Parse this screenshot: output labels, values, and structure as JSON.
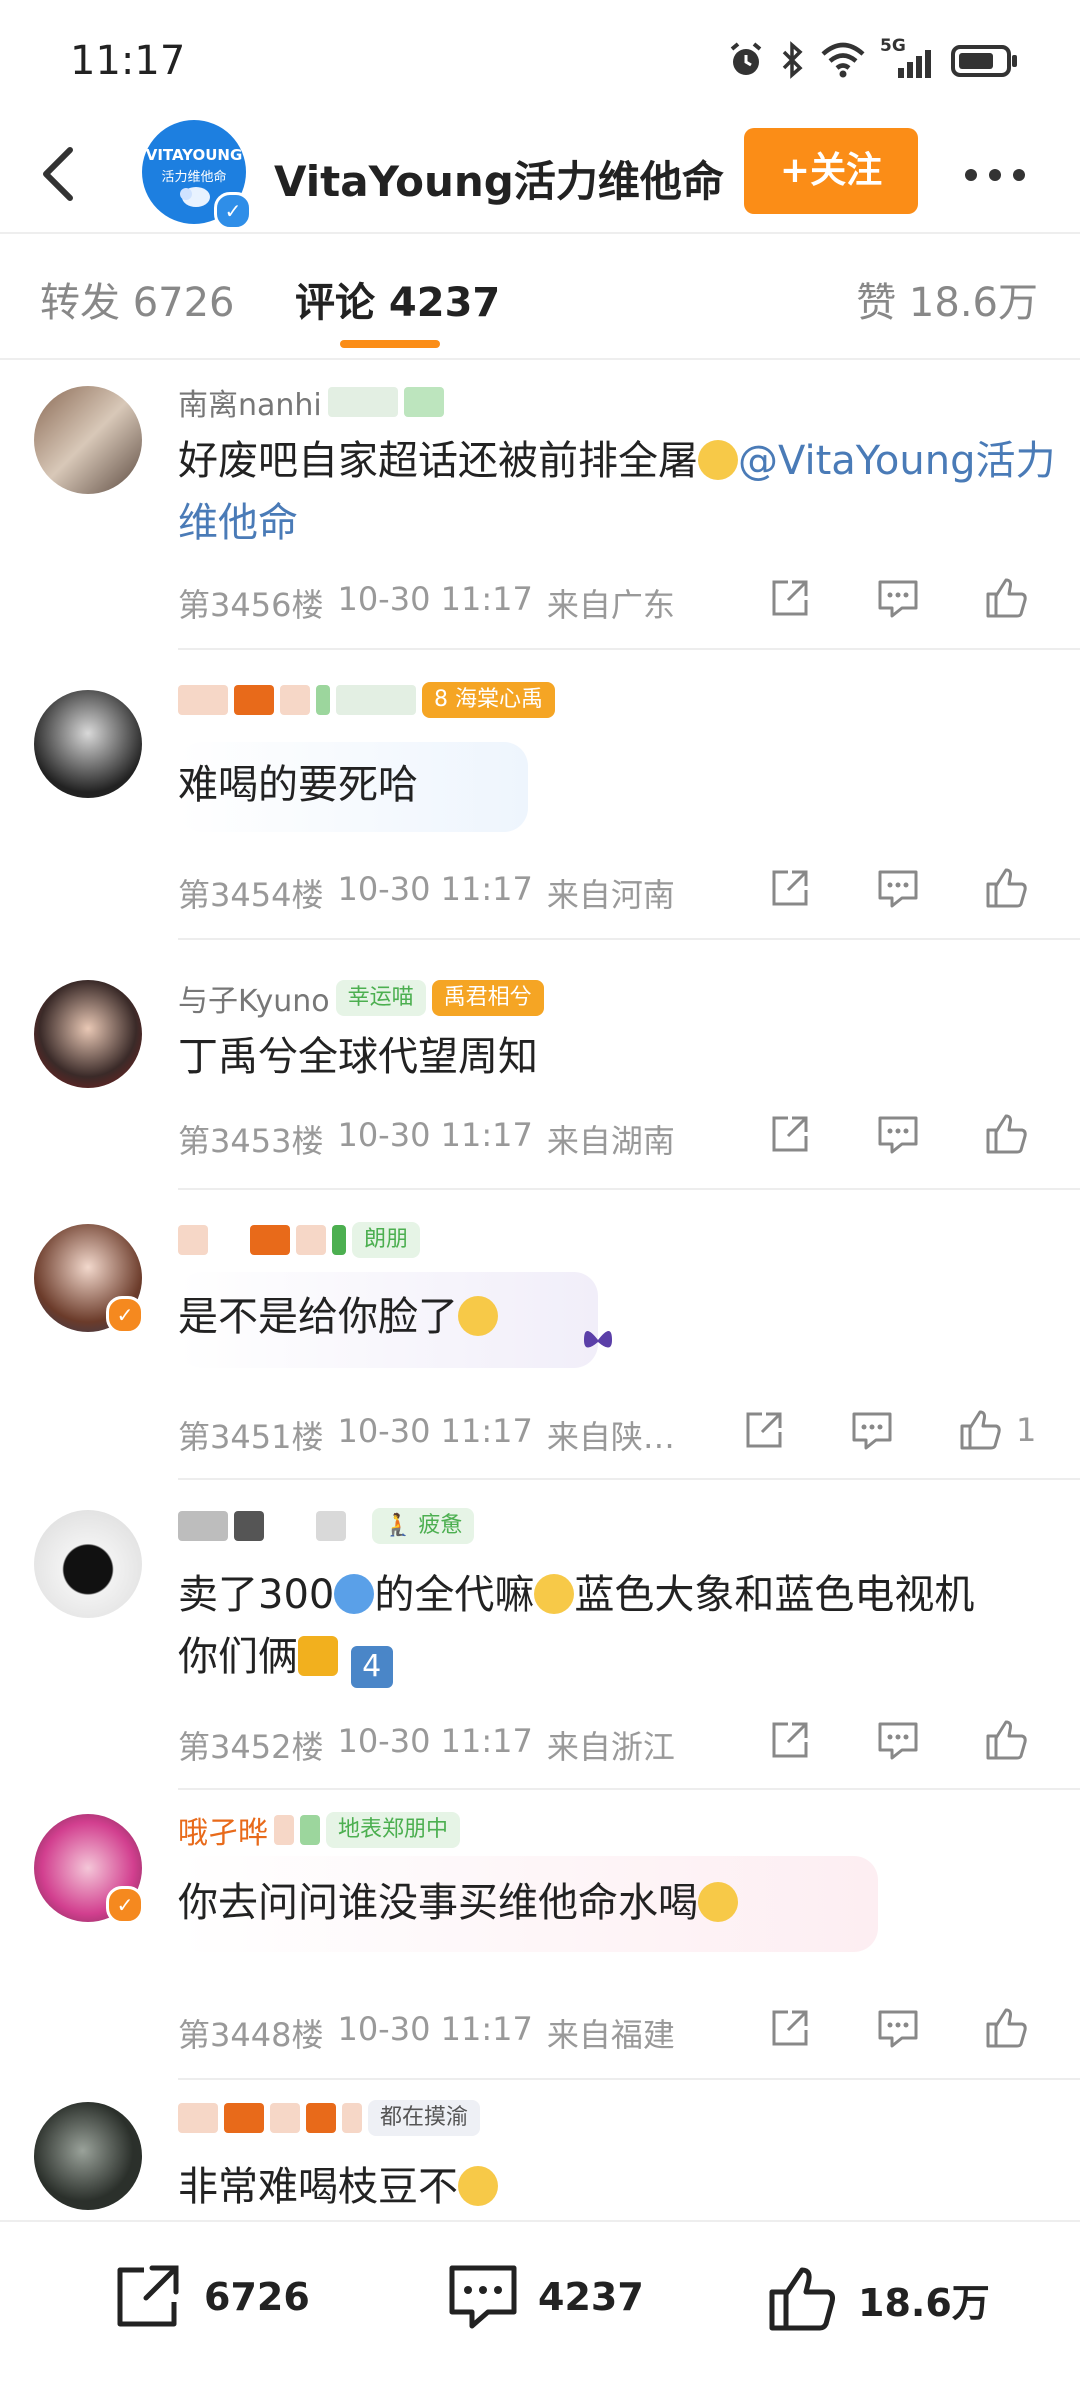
{
  "status_bar": {
    "time": "11:17",
    "network": "5G"
  },
  "header": {
    "brand_logo_line1": "VITAYOUNG",
    "brand_logo_line2": "活力维他命",
    "title": "VitaYoung活力维他命",
    "follow_label": "+关注",
    "more_icon": "more-icon"
  },
  "tabs": {
    "repost": "转发 6726",
    "comment": "评论 4237",
    "like": "赞 18.6万"
  },
  "comments": [
    {
      "user_fragment": "南离nanhi",
      "text_before": "好废吧自家超话还被前排全屠",
      "emoji": "crying-face",
      "mention": "@VitaYoung活力维他命",
      "floor": "第3456楼",
      "time": "10-30 11:17",
      "location": "来自广东",
      "likes": ""
    },
    {
      "badge": "海棠心禹",
      "badge_level": "8",
      "text": "难喝的要死哈",
      "floor": "第3454楼",
      "time": "10-30 11:17",
      "location": "来自河南",
      "likes": ""
    },
    {
      "user_fragment": "与子Kyuno",
      "badge_green": "幸运喵",
      "badge": "禹君相兮",
      "text": "丁禹兮全球代望周知",
      "floor": "第3453楼",
      "time": "10-30 11:17",
      "location": "来自湖南",
      "likes": ""
    },
    {
      "badge": "朗朋",
      "text": "是不是给你脸了",
      "emoji": "laughing-face",
      "floor": "第3451楼",
      "time": "10-30 11:17",
      "location": "来自陕…",
      "likes": "1"
    },
    {
      "badge": "疲惫",
      "text_line1_a": "卖了300",
      "text_line1_b": "的全代嘛",
      "text_line1_c": "蓝色大象和蓝色电视机",
      "text_line2": "你们俩",
      "floor": "第3452楼",
      "time": "10-30 11:17",
      "location": "来自浙江",
      "likes": ""
    },
    {
      "user_fragment": "哦孑晔",
      "badge": "地表郑朋中",
      "text": "你去问问谁没事买维他命水喝",
      "emoji": "sleepy-face",
      "floor": "第3448楼",
      "time": "10-30 11:17",
      "location": "来自福建",
      "likes": ""
    },
    {
      "badge": "都在摸渝",
      "text": "非常难喝枝豆不",
      "emoji": "speechless-face"
    }
  ],
  "bottom_bar": {
    "repost_count": "6726",
    "comment_count": "4237",
    "like_count": "18.6万"
  },
  "colors": {
    "accent": "#fb8d17",
    "link": "#4a7bb7",
    "meta": "#999999"
  }
}
